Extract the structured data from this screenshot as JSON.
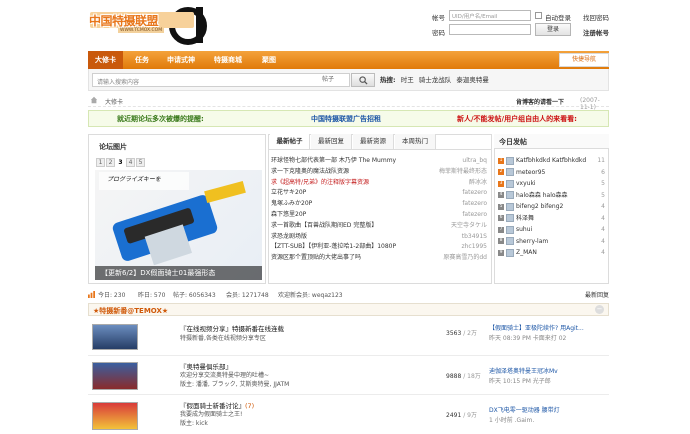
{
  "logo": {
    "text": "中国特摄联盟",
    "url": "WWW.TCMOX.COM"
  },
  "login": {
    "account_label": "帐号",
    "account_placeholder": "UID/用户名/Email",
    "auto_login": "自动登录",
    "recover": "找回密码",
    "password_label": "密码",
    "login_button": "登录",
    "register": "注册帐号"
  },
  "nav": {
    "items": [
      "大修卡",
      "任务",
      "申请式神",
      "特摄商城",
      "聚图"
    ],
    "quick": "快捷导航"
  },
  "search": {
    "placeholder": "请输入搜索内容",
    "type": "帖子",
    "hot_label": "热搜:",
    "hot_terms": [
      "时王",
      "骑士龙战队",
      "泰迦奥特曼"
    ]
  },
  "crumbs": {
    "home": "大修卡",
    "right_text": "肯博客的请看一下",
    "right_date": "(2007-11-1)"
  },
  "notices": [
    {
      "text": "就近期论坛多次被爆的提醒:",
      "color": "#3a7a1b"
    },
    {
      "text": "中国特摄联盟广告招租",
      "color": "#1c56a6"
    },
    {
      "text": "新人/不能发帖/用户组自由人的来看看:",
      "color": "#cc1212"
    }
  ],
  "gallery": {
    "title": "论坛图片",
    "pages": [
      "1",
      "2",
      "3",
      "4",
      "5"
    ],
    "active_page": "3",
    "caption": "【更新6/2】DX假面骑士01最强形态",
    "box_text": "プログライズキーを"
  },
  "tabs": [
    "最新帖子",
    "最新回复",
    "最新资源",
    "本周热门"
  ],
  "threads": [
    {
      "title": "环球怪物七部代表第一部 木乃伊 The Mummy",
      "author": "ultra_bq",
      "color": "#333"
    },
    {
      "title": "求一下克隆奥的魔法战队资源",
      "author": "梅菲斯特最终形态",
      "color": "#333"
    },
    {
      "title": "求《超高特/兄弟》的注释版字幕资源",
      "author": "醉冰冰",
      "color": "#c31a1a"
    },
    {
      "title": "立花サキ20P",
      "author": "fatezero",
      "color": "#333"
    },
    {
      "title": "鬼塚ふみか20P",
      "author": "fatezero",
      "color": "#333"
    },
    {
      "title": "森下悠里20P",
      "author": "fatezero",
      "color": "#333"
    },
    {
      "title": "求一首歌曲【百兽战队期间ED 完整版】",
      "author": "天空寺タケル",
      "color": "#333"
    },
    {
      "title": "求恐龙剧场版",
      "author": "tb3491S",
      "color": "#333"
    },
    {
      "title": "【ZTT-SUB】【伊利亚-蓬拉哈1-2部曲】1080P",
      "author": "zhc1995",
      "color": "#333"
    },
    {
      "title": "资源区那个置顶贴的大佬出事了吗",
      "author": "原赛高雪乃的dd",
      "color": "#333"
    }
  ],
  "today": {
    "title": "今日发帖",
    "users": [
      {
        "rank": "1",
        "name": "Katfbhkdkd Katfbhkdkd",
        "count": "11",
        "color": "#e8761a"
      },
      {
        "rank": "2",
        "name": "meteor95",
        "count": "6",
        "color": "#e8761a"
      },
      {
        "rank": "3",
        "name": "vxyuki",
        "count": "5",
        "color": "#e8761a"
      },
      {
        "rank": "4",
        "name": "halo森森 halo森森",
        "count": "5",
        "color": "#888"
      },
      {
        "rank": "5",
        "name": "bifeng2 bifeng2",
        "count": "4",
        "color": "#888"
      },
      {
        "rank": "6",
        "name": "科泽舞",
        "count": "4",
        "color": "#888"
      },
      {
        "rank": "7",
        "name": "suhui",
        "count": "4",
        "color": "#888"
      },
      {
        "rank": "8",
        "name": "sherry-lam",
        "count": "4",
        "color": "#888"
      },
      {
        "rank": "9",
        "name": "Z_MAN",
        "count": "4",
        "color": "#888"
      }
    ]
  },
  "stats": {
    "today": "今日: 230",
    "yesterday": "昨日: 570",
    "posts": "帖子: 6056343",
    "members": "会员: 1271748",
    "newest": "欢迎新会员: weqaz123",
    "right": "最新回复"
  },
  "forum": {
    "title": "★特摄新番@TEMOX★",
    "rows": [
      {
        "title": "『在线视频分享』特摄新番在线连载",
        "desc": "特摄新番,各类在线视频分享专区",
        "count": "3563",
        "total": "2万",
        "last_title": "【假面骑士】亚极陀续作? 用Agit...",
        "last_time": "昨天 08:39 PM 卡面来打 02",
        "title_color": "#1c56a6"
      },
      {
        "title": "『奥特曼俱乐部』",
        "desc": "欢迎分享交流奥特曼中理的吐槽~",
        "mod": "版主: 潘潘, ブラック, 艾斯奥特曼, JJATM",
        "count": "9888",
        "total": "18万",
        "last_title": "迪伽泽塔奥特曼王冠冰Mv",
        "last_time": "昨天 10:15 PM 光子郎",
        "title_color": "#1c56a6"
      },
      {
        "title": "『假面骑士新番讨论』",
        "badge": "(7)",
        "desc": "我要成为假面骑士之王!",
        "mod": "版主: kick",
        "count": "2491",
        "total": "9万",
        "last_title": "DX飞电零一驱动器 腰带灯",
        "last_time": "1 小时前 .Gaim.",
        "title_color": "#1c56a6"
      }
    ]
  }
}
